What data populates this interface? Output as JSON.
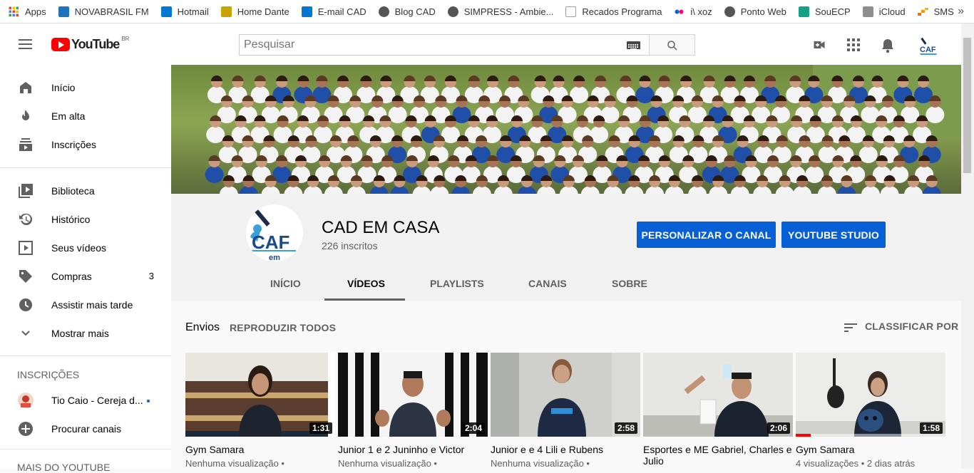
{
  "bookmarks": [
    {
      "label": "Apps",
      "icon": "apps-grid-icon",
      "color": "#4285f4"
    },
    {
      "label": "NOVABRASIL FM",
      "icon": "s-logo-icon",
      "color": "#1e73be"
    },
    {
      "label": "Hotmail",
      "icon": "outlook-icon",
      "color": "#0078d4"
    },
    {
      "label": "Home Dante",
      "icon": "dante-crest-icon",
      "color": "#c8a400"
    },
    {
      "label": "E-mail CAD",
      "icon": "outlook-icon",
      "color": "#0078d4"
    },
    {
      "label": "Blog CAD",
      "icon": "globe-icon",
      "color": "#555555"
    },
    {
      "label": "SIMPRESS - Ambie...",
      "icon": "globe-icon",
      "color": "#555555"
    },
    {
      "label": "Recados Programa",
      "icon": "page-icon",
      "color": "#9e9e9e"
    },
    {
      "label": "i\\ xoz",
      "icon": "flickr-icon",
      "color": "#ff0084"
    },
    {
      "label": "Ponto Web",
      "icon": "globe-icon",
      "color": "#555555"
    },
    {
      "label": "SouECP",
      "icon": "souecp-icon",
      "color": "#16a085"
    },
    {
      "label": "iCloud",
      "icon": "apple-icon",
      "color": "#8e8e8e"
    },
    {
      "label": "SMS",
      "icon": "sms-icon",
      "color": "#ff6d00"
    }
  ],
  "bookmarks_more": "»",
  "masthead": {
    "logo_text": "YouTube",
    "logo_region": "BR",
    "search_placeholder": "Pesquisar"
  },
  "sidebar": {
    "main": [
      {
        "label": "Início",
        "icon": "home-icon"
      },
      {
        "label": "Em alta",
        "icon": "flame-icon"
      },
      {
        "label": "Inscrições",
        "icon": "subscriptions-icon"
      }
    ],
    "library": [
      {
        "label": "Biblioteca",
        "icon": "library-icon",
        "count": ""
      },
      {
        "label": "Histórico",
        "icon": "history-icon",
        "count": ""
      },
      {
        "label": "Seus vídeos",
        "icon": "your-videos-icon",
        "count": ""
      },
      {
        "label": "Compras",
        "icon": "tag-icon",
        "count": "3"
      },
      {
        "label": "Assistir mais tarde",
        "icon": "clock-icon",
        "count": ""
      },
      {
        "label": "Mostrar mais",
        "icon": "chevron-down-icon",
        "count": ""
      }
    ],
    "subs_heading": "INSCRIÇÕES",
    "subscriptions": [
      {
        "label": "Tio Caio - Cereja d...",
        "icon": "channel-avatar-icon"
      },
      {
        "label": "Procurar canais",
        "icon": "add-circle-icon"
      }
    ],
    "more_heading": "MAIS DO YOUTUBE"
  },
  "channel": {
    "name": "CAD EM CASA",
    "subscribers": "226 inscritos",
    "customize_label": "PERSONALIZAR O CANAL",
    "studio_label": "YOUTUBE STUDIO",
    "tabs": [
      "INÍCIO",
      "VÍDEOS",
      "PLAYLISTS",
      "CANAIS",
      "SOBRE"
    ],
    "active_tab": "VÍDEOS"
  },
  "uploads": {
    "title": "Envios",
    "play_all": "REPRODUZIR TODOS",
    "sort_label": "CLASSIFICAR POR"
  },
  "videos": [
    {
      "title": "Gym Samara",
      "duration": "1:31",
      "meta": "Nenhuma visualização •",
      "progress": 0
    },
    {
      "title": "Junior 1 e 2 Juninho e Victor",
      "duration": "2:04",
      "meta": "Nenhuma visualização •",
      "progress": 0
    },
    {
      "title": "Junior e e 4 Lili e Rubens",
      "duration": "2:58",
      "meta": "Nenhuma visualização •",
      "progress": 0
    },
    {
      "title": "Esportes e ME Gabriel, Charles e Julio",
      "duration": "2:06",
      "meta": "",
      "progress": 0
    },
    {
      "title": "Gym Samara",
      "duration": "1:58",
      "meta": "4 visualizações • 2 dias atrás",
      "progress": 0.1
    }
  ],
  "colors": {
    "accent_blue": "#065fd4",
    "youtube_red": "#ff0000"
  }
}
